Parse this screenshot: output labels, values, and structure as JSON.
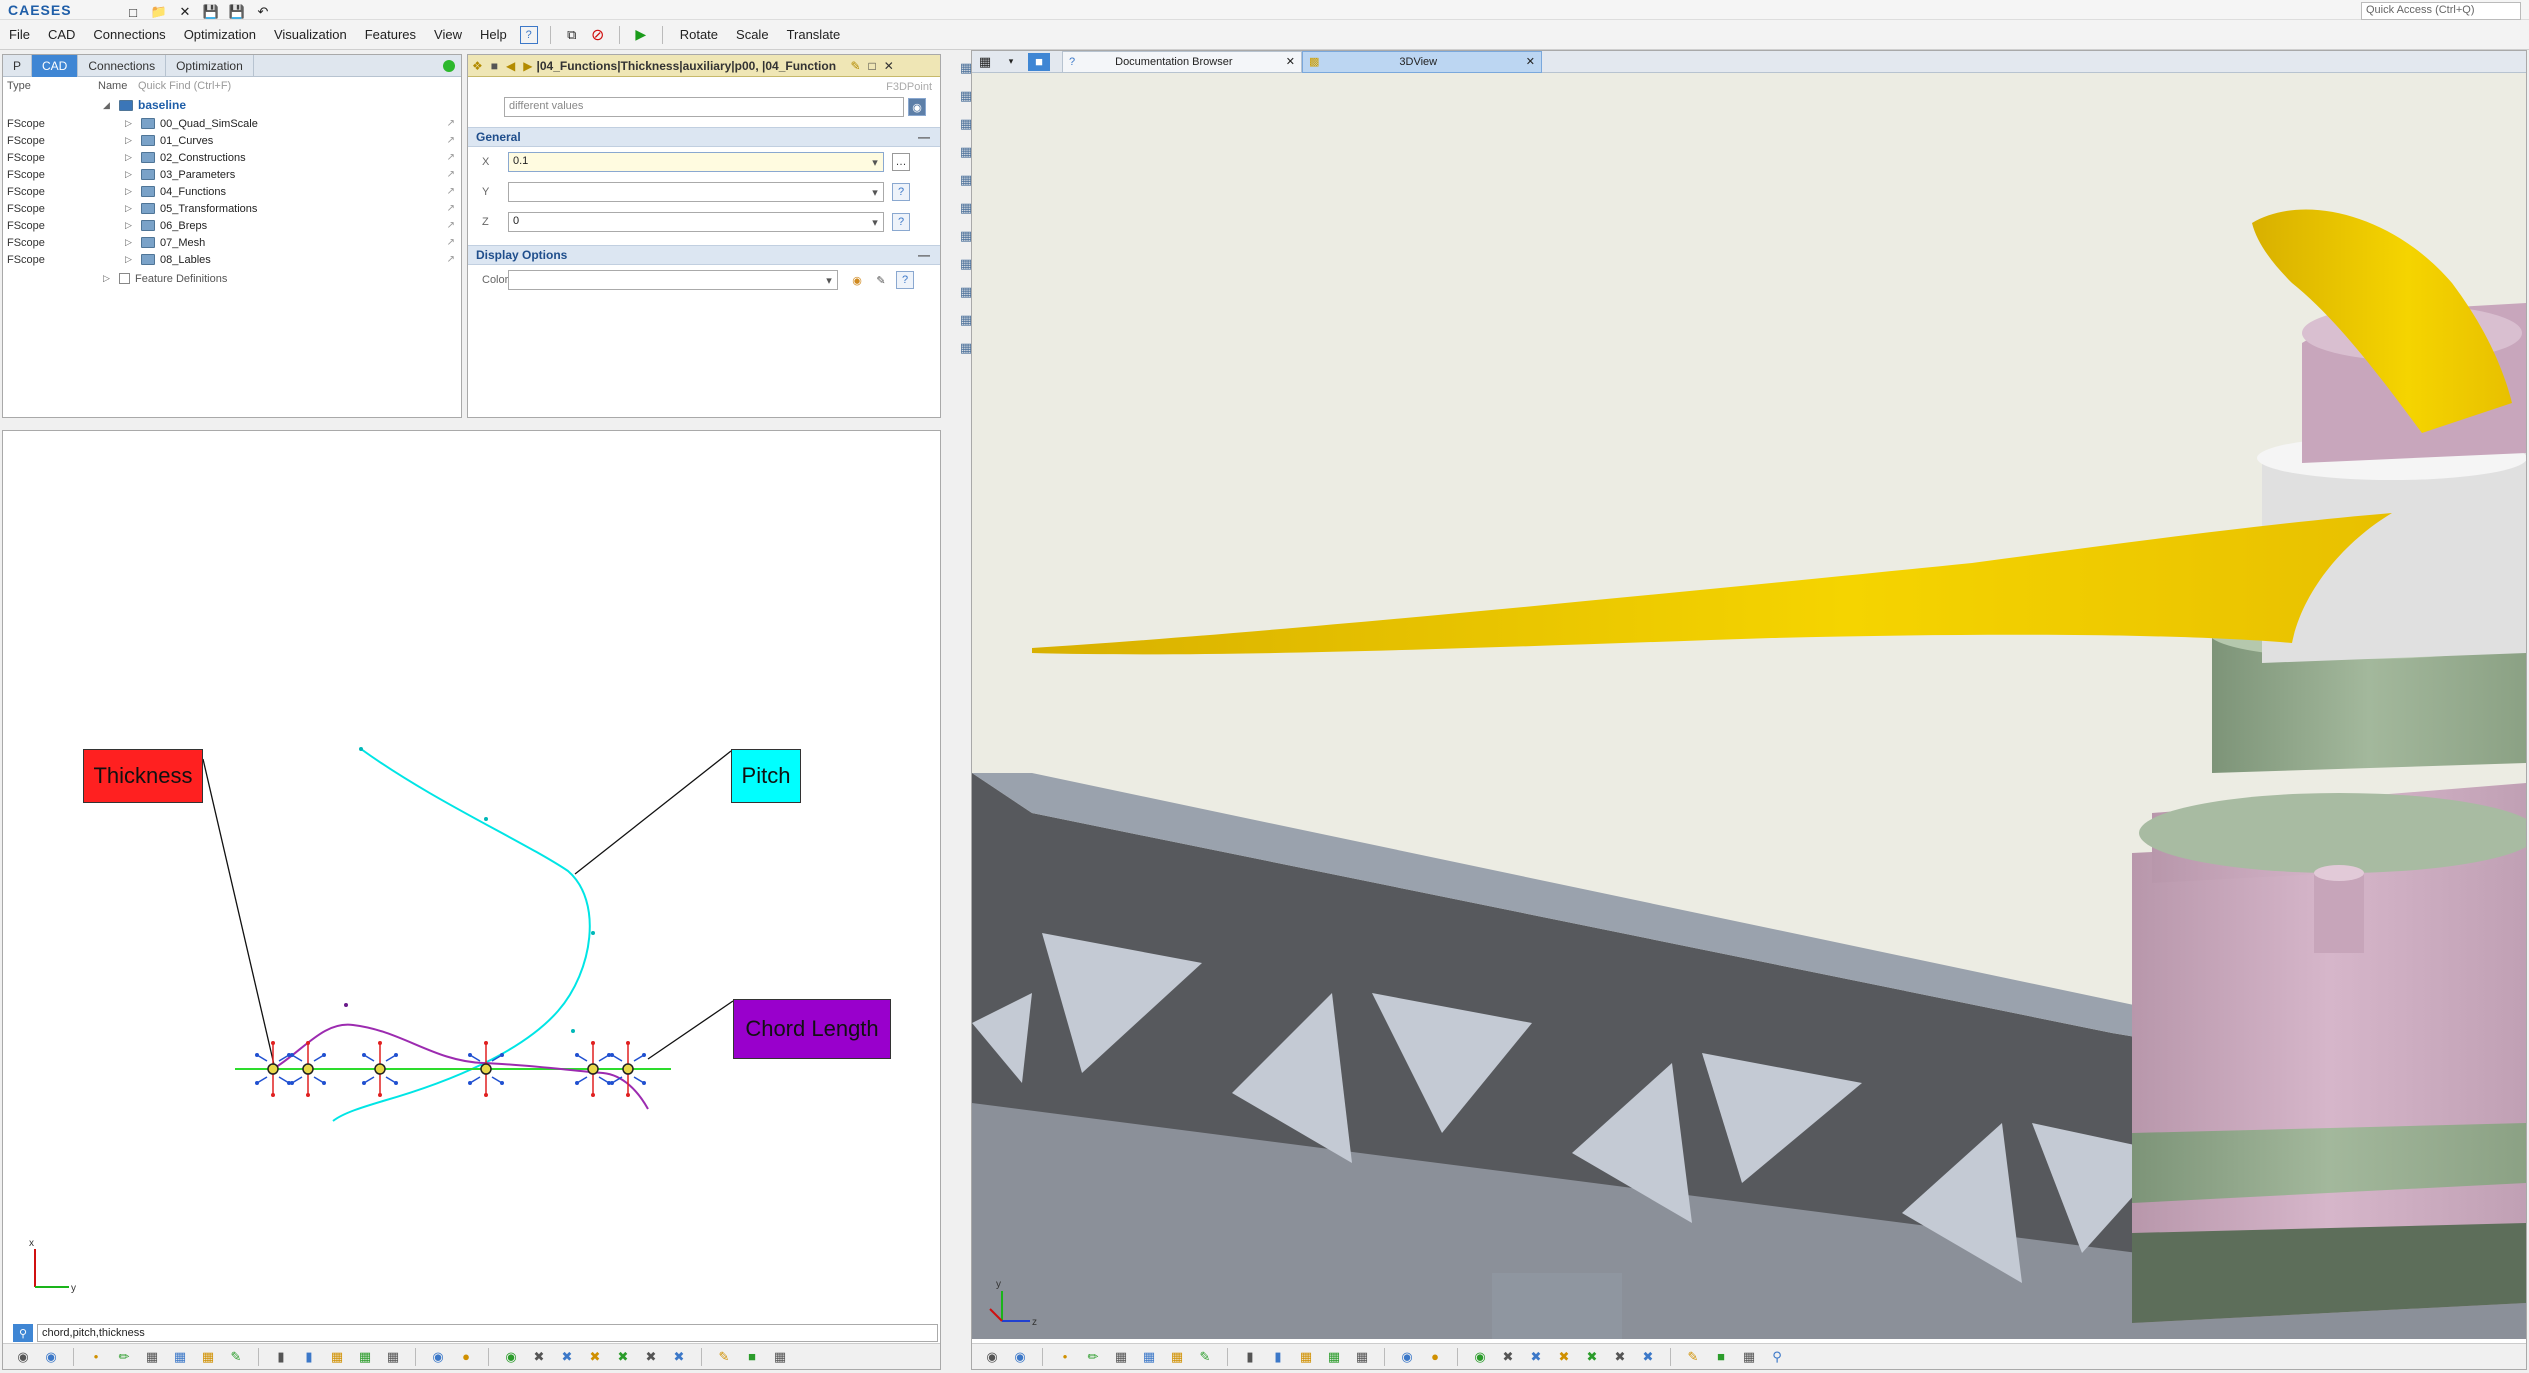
{
  "app": {
    "logo": "CAESES",
    "quick_access_placeholder": "Quick Access (Ctrl+Q)"
  },
  "menu": {
    "items": [
      "File",
      "CAD",
      "Connections",
      "Optimization",
      "Visualization",
      "Features",
      "View",
      "Help"
    ],
    "toolbar_actions": [
      "Rotate",
      "Scale",
      "Translate"
    ]
  },
  "object_tree": {
    "tabs": [
      "P",
      "CAD",
      "Connections",
      "Optimization"
    ],
    "active_tab": "CAD",
    "columns": [
      "Type",
      "Name"
    ],
    "quick_find_placeholder": "Quick Find (Ctrl+F)",
    "root": "baseline",
    "rows": [
      {
        "type": "FScope",
        "name": "00_Quad_SimScale"
      },
      {
        "type": "FScope",
        "name": "01_Curves"
      },
      {
        "type": "FScope",
        "name": "02_Constructions"
      },
      {
        "type": "FScope",
        "name": "03_Parameters"
      },
      {
        "type": "FScope",
        "name": "04_Functions"
      },
      {
        "type": "FScope",
        "name": "05_Transformations"
      },
      {
        "type": "FScope",
        "name": "06_Breps"
      },
      {
        "type": "FScope",
        "name": "07_Mesh"
      },
      {
        "type": "FScope",
        "name": "08_Lables"
      }
    ],
    "feature_definitions": "Feature Definitions"
  },
  "properties": {
    "title": "|04_Functions|Thickness|auxiliary|p00, |04_Function",
    "type_label": "F3DPoint",
    "different_values": "different values",
    "general_label": "General",
    "x_label": "X",
    "x_value": "0.1",
    "y_label": "Y",
    "y_value": "",
    "z_label": "Z",
    "z_value": "0",
    "display_options_label": "Display Options",
    "color_label": "Color"
  },
  "view2d": {
    "labels": {
      "thickness": "Thickness",
      "pitch": "Pitch",
      "chord_length": "Chord Length"
    },
    "filter_value": "chord,pitch,thickness",
    "colors": {
      "thickness": "#ff2020",
      "pitch": "#00ffff",
      "chord_length": "#9900cc"
    }
  },
  "view3d": {
    "tabs": [
      "Documentation Browser",
      "3DView"
    ],
    "active_tab": "3DView"
  }
}
